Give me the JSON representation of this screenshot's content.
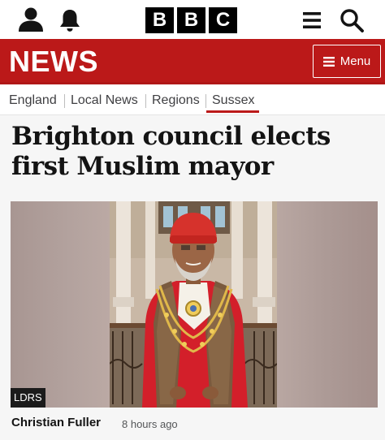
{
  "header": {
    "logo_letters": [
      "B",
      "B",
      "C"
    ],
    "icons": [
      "account-icon",
      "notifications-bell-icon",
      "hamburger-menu-icon",
      "search-icon"
    ]
  },
  "banner": {
    "section_title": "NEWS",
    "menu_label": "Menu",
    "color": "#bb1919"
  },
  "breadcrumbs": {
    "items": [
      "England",
      "Local News",
      "Regions",
      "Sussex"
    ],
    "active": "Sussex"
  },
  "article": {
    "headline": "Brighton council elects first Muslim mayor",
    "image_credit_badge": "LDRS",
    "author": "Christian Fuller",
    "published": "8 hours ago"
  }
}
